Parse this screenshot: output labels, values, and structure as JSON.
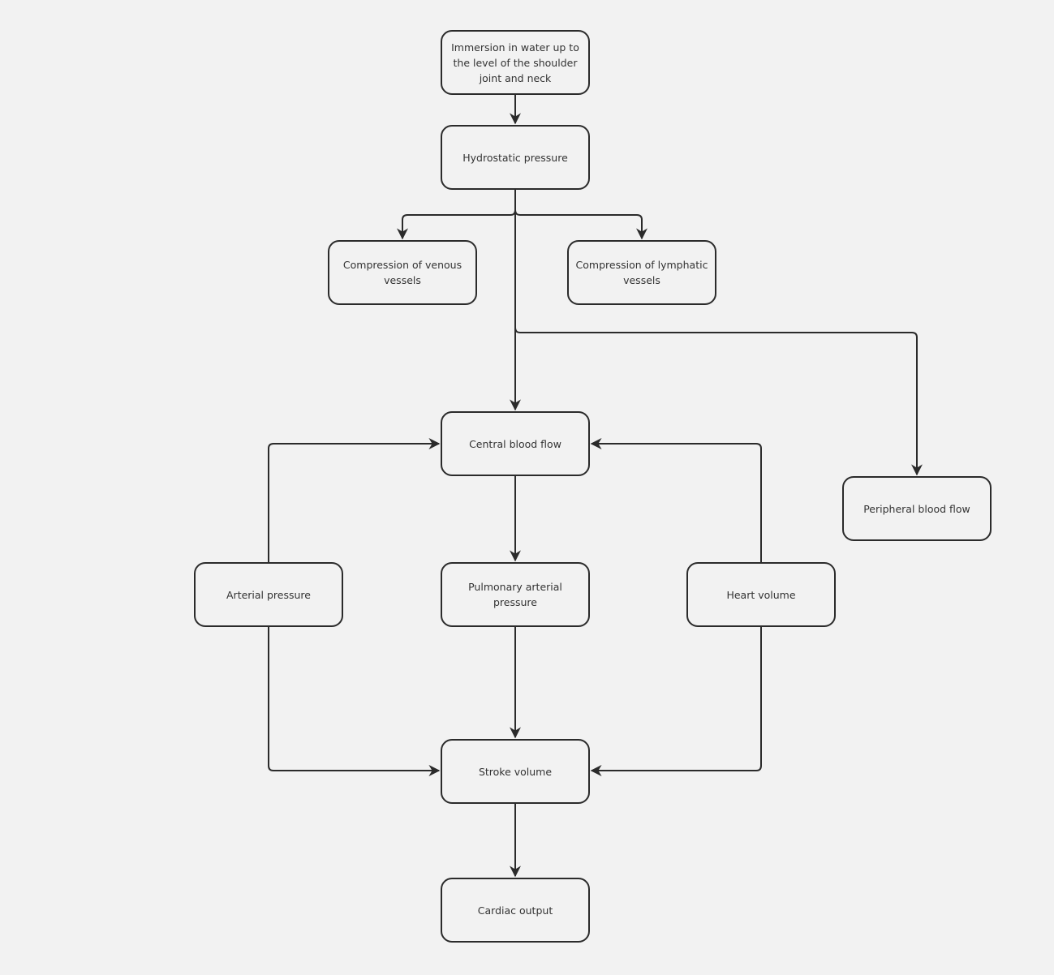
{
  "diagram": {
    "colors": {
      "background": "#f2f2f2",
      "stroke": "#2b2b2b",
      "text": "#333333"
    },
    "nodes": {
      "immersion": "Immersion in water up to the level of the shoulder joint and neck",
      "hydrostatic": "Hydrostatic pressure",
      "venous": "Compression of venous vessels",
      "lymphatic": "Compression of lymphatic vessels",
      "central": "Central blood flow",
      "peripheral": "Peripheral blood flow",
      "arterial": "Arterial pressure",
      "pulmonary": "Pulmonary arterial pressure",
      "heart": "Heart volume",
      "stroke": "Stroke volume",
      "cardiac": "Cardiac output"
    },
    "edges": [
      {
        "from": "immersion",
        "to": "hydrostatic"
      },
      {
        "from": "hydrostatic",
        "to": "venous"
      },
      {
        "from": "hydrostatic",
        "to": "lymphatic"
      },
      {
        "from": "hydrostatic",
        "to": "central"
      },
      {
        "from": "hydrostatic",
        "to": "peripheral"
      },
      {
        "from": "central",
        "to": "pulmonary"
      },
      {
        "from": "pulmonary",
        "to": "stroke"
      },
      {
        "from": "stroke",
        "to": "cardiac"
      },
      {
        "from": "arterial",
        "to": "central"
      },
      {
        "from": "arterial",
        "to": "stroke"
      },
      {
        "from": "heart",
        "to": "central"
      },
      {
        "from": "heart",
        "to": "stroke"
      }
    ]
  }
}
